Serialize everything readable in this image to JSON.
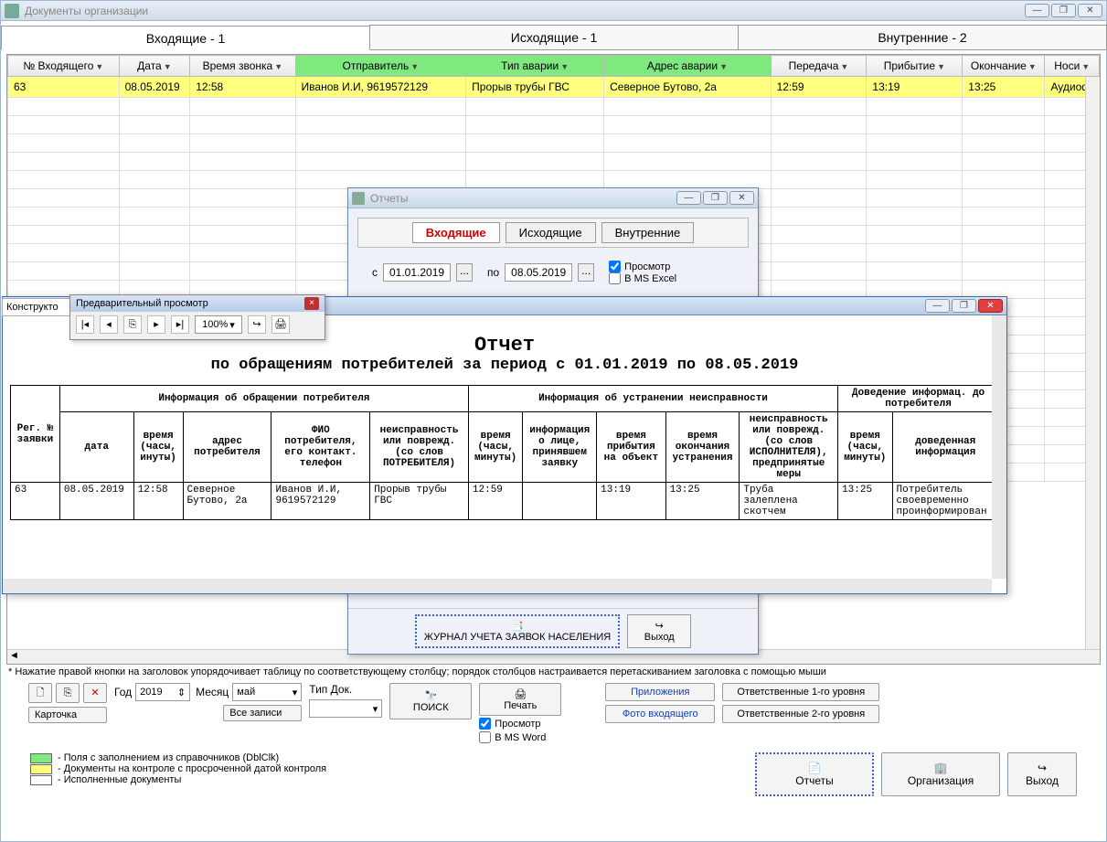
{
  "main_window": {
    "title": "Документы организации"
  },
  "tabs": {
    "incoming": "Входящие - 1",
    "outgoing": "Исходящие - 1",
    "internal": "Внутренние - 2"
  },
  "grid": {
    "headers": {
      "num": "№ Входящего",
      "date": "Дата",
      "time": "Время звонка",
      "sender": "Отправитель",
      "fault_type": "Тип аварии",
      "fault_addr": "Адрес аварии",
      "transfer": "Передача",
      "arrival": "Прибытие",
      "end": "Окончание",
      "carrier": "Носи"
    },
    "row": {
      "num": "63",
      "date": "08.05.2019",
      "time": "12:58",
      "sender": "Иванов И.И, 9619572129",
      "fault_type": "Прорыв трубы ГВС",
      "fault_addr": "Северное Бутово, 2а",
      "transfer": "12:59",
      "arrival": "13:19",
      "end": "13:25",
      "carrier": "Аудиоф"
    }
  },
  "side_tab": "Конструкто",
  "hint": "* Нажатие правой кнопки на заголовок упорядочивает таблицу по соответствующему  столбцу;  порядок столбцов настраивается перетаскиванием заголовка с помощью мыши",
  "bottom": {
    "card": "Карточка",
    "year_label": "Год",
    "year_value": "2019",
    "month_label": "Месяц",
    "month_value": "май",
    "all_records": "Все записи",
    "doc_type": "Тип Док.",
    "search": "ПОИСК",
    "print": "Печать",
    "preview_cb": "Просмотр",
    "msword_cb": "В MS Word",
    "attachments": "Приложения",
    "photo": "Фото входящего",
    "resp1": "Ответственные 1-го уровня",
    "resp2": "Ответственные 2-го уровня"
  },
  "legend": {
    "l1": "- Поля с заполнением из справочников (DblClk)",
    "l2": "- Документы на контроле с просроченной датой контроля",
    "l3": "- Исполненные документы"
  },
  "footer": {
    "reports": "Отчеты",
    "org": "Организация",
    "exit": "Выход"
  },
  "dlg_reports": {
    "title": "Отчеты",
    "tab_in": "Входящие",
    "tab_out": "Исходящие",
    "tab_int": "Внутренние",
    "from": "с",
    "from_date": "01.01.2019",
    "to": "по",
    "to_date": "08.05.2019",
    "preview_cb": "Просмотр",
    "excel_cb": "В MS Excel",
    "journal_btn": "ЖУРНАЛ УЧЕТА ЗАЯВОК НАСЕЛЕНИЯ",
    "exit": "Выход"
  },
  "preview_toolbar": {
    "title": "Предварительный просмотр",
    "zoom": "100%"
  },
  "report": {
    "title": "Отчет",
    "subtitle": "по обращениям потребителей за период с 01.01.2019 по 08.05.2019",
    "group1": "Информация об обращении потребителя",
    "group2": "Информация об устранении неисправности",
    "group3": "Доведение информац. до потребителя",
    "h_regnum": "Рег. № заявки",
    "h_date": "дата",
    "h_time": "время (часы, инуты)",
    "h_addr": "адрес потребителя",
    "h_fio": "ФИО потребителя, его контакт. телефон",
    "h_fault": "неисправность или поврежд. (со слов ПОТРЕБИТЕЛЯ)",
    "h_time2": "время (часы, минуты)",
    "h_person": "информация о лице, принявшем заявку",
    "h_arrive": "время прибытия на объект",
    "h_finish": "время окончания устранения",
    "h_fault2": "неисправность или поврежд. (со слов ИСПОЛНИТЕЛЯ), предпринятые меры",
    "h_time3": "время (часы, минуты)",
    "h_info": "доведенная информация",
    "r_num": "63",
    "r_date": "08.05.2019",
    "r_time": "12:58",
    "r_addr": "Северное Бутово, 2а",
    "r_fio": "Иванов И.И, 9619572129",
    "r_fault": "Прорыв трубы ГВС",
    "r_time2": "12:59",
    "r_person": "",
    "r_arrive": "13:19",
    "r_finish": "13:25",
    "r_fault2": "Труба залеплена скотчем",
    "r_time3": "13:25",
    "r_info": "Потребитель своевременно проинформирован"
  }
}
